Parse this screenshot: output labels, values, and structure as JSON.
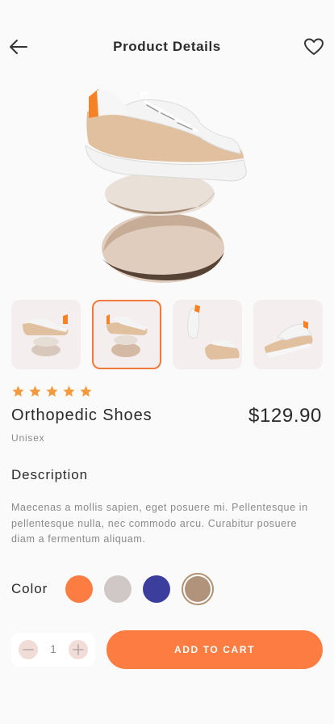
{
  "header": {
    "title": "Product Details",
    "back_icon": "arrow-left-icon",
    "favorite_icon": "heart-icon"
  },
  "product": {
    "rating": 5,
    "name": "Orthopedic Shoes",
    "price": "$129.90",
    "category": "Unisex"
  },
  "gallery": {
    "selected_index": 1,
    "count": 4
  },
  "description": {
    "title": "Description",
    "text": "Maecenas a mollis sapien, eget posuere mi. Pellentesque in pellentesque nulla, nec commodo arcu. Curabitur posuere diam a fermentum aliquam."
  },
  "color": {
    "label": "Color",
    "options": [
      "#fd7c42",
      "#cfc8c6",
      "#3c3e9e",
      "#b0937a"
    ],
    "selected_index": 3
  },
  "quantity": {
    "value": "1",
    "minus_icon": "minus-icon",
    "plus_icon": "plus-icon"
  },
  "cart": {
    "label": "ADD TO CART"
  },
  "colors": {
    "accent": "#fd7c42",
    "star": "#f59a3c",
    "thumb_bg": "#f4efee"
  }
}
